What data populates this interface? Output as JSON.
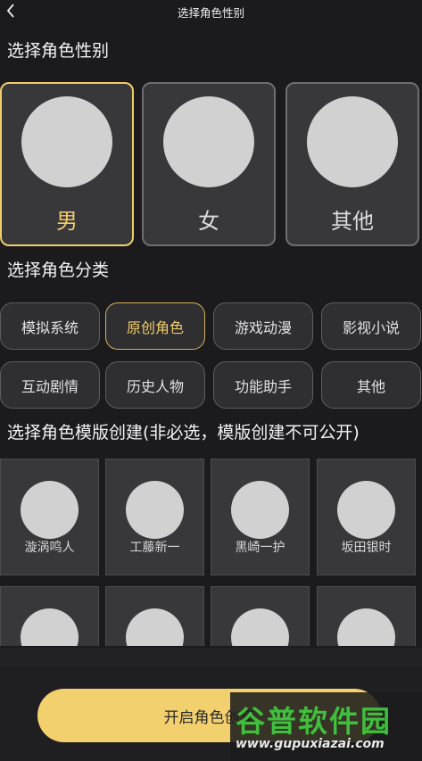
{
  "header": {
    "title": "选择角色性别",
    "back_icon": "chevron-left-icon"
  },
  "gender_section": {
    "title": "选择角色性别",
    "options": [
      {
        "label": "男",
        "selected": true
      },
      {
        "label": "女",
        "selected": false
      },
      {
        "label": "其他",
        "selected": false
      }
    ]
  },
  "category_section": {
    "title": "选择角色分类",
    "items": [
      {
        "label": "模拟系统",
        "selected": false
      },
      {
        "label": "原创角色",
        "selected": true
      },
      {
        "label": "游戏动漫",
        "selected": false
      },
      {
        "label": "影视小说",
        "selected": false
      },
      {
        "label": "互动剧情",
        "selected": false
      },
      {
        "label": "历史人物",
        "selected": false
      },
      {
        "label": "功能助手",
        "selected": false
      },
      {
        "label": "其他",
        "selected": false
      }
    ]
  },
  "template_section": {
    "title": "选择角色模版创建(非必选，模版创建不可公开)",
    "templates": [
      {
        "name": "漩涡鸣人"
      },
      {
        "name": "工藤新一"
      },
      {
        "name": "黑崎一护"
      },
      {
        "name": "坂田银时"
      },
      {
        "name": ""
      },
      {
        "name": ""
      },
      {
        "name": ""
      },
      {
        "name": ""
      }
    ]
  },
  "footer": {
    "button_label": "开启角色创建"
  },
  "watermark": {
    "brand": "谷普软件园",
    "url": "www.gupuxiazai.com"
  },
  "colors": {
    "accent": "#f0cc6b",
    "button": "#f3d06e",
    "background": "#1b1b1d",
    "card": "#38383b"
  }
}
